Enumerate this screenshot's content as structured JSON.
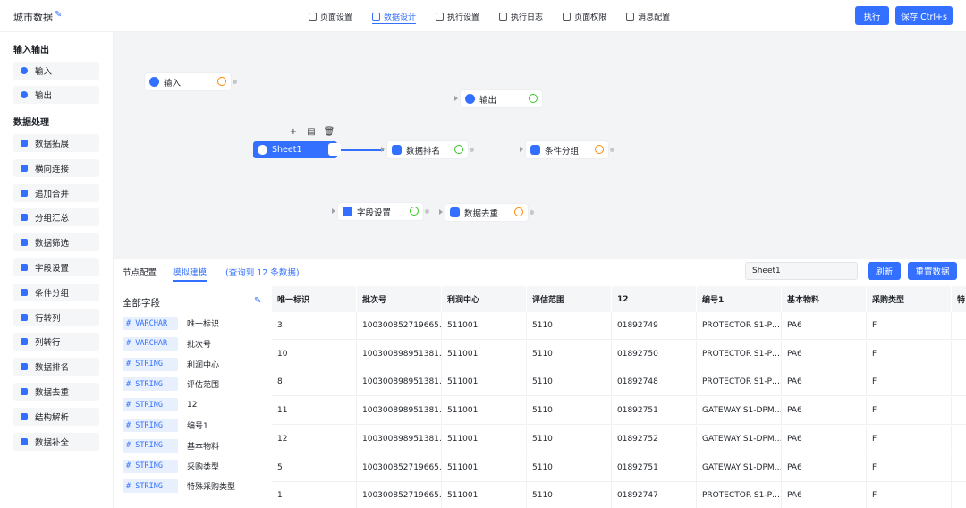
{
  "app": {
    "title": "城市数据",
    "accent": "#3370ff"
  },
  "nav": [
    "页面设置",
    "数据设计",
    "执行设置",
    "执行日志",
    "页面权限",
    "消息配置"
  ],
  "actions": {
    "run": "执行",
    "save": "保存 Ctrl+s"
  },
  "sidebar": {
    "io_title": "输入输出",
    "io_items": [
      "输入",
      "输出"
    ],
    "proc_title": "数据处理",
    "proc_items": [
      "数据拓展",
      "横向连接",
      "追加合并",
      "分组汇总",
      "数据筛选",
      "字段设置",
      "条件分组",
      "行转列",
      "列转行",
      "数据排名",
      "数据去重",
      "结构解析",
      "数据补全"
    ]
  },
  "canvas": {
    "nodes": {
      "input": "输入",
      "output": "输出",
      "sheet": "Sheet1",
      "rank": "数据排名",
      "group": "条件分组",
      "field": "字段设置",
      "dedup": "数据去重"
    },
    "mini_toolbar": [
      "+",
      "▤",
      "🗑"
    ]
  },
  "bottom": {
    "tabs": [
      "节点配置",
      "模拟建模"
    ],
    "query_info": "(查询到 12 条数据)",
    "search_value": "Sheet1",
    "refresh": "刷新",
    "reset": "重置数据",
    "fields_title": "全部字段",
    "fields": [
      {
        "type": "# VARCHAR",
        "name": "唯一标识"
      },
      {
        "type": "# VARCHAR",
        "name": "批次号"
      },
      {
        "type": "# STRING",
        "name": "利润中心"
      },
      {
        "type": "# STRING",
        "name": "评估范围"
      },
      {
        "type": "# STRING",
        "name": "12"
      },
      {
        "type": "# STRING",
        "name": "编号1"
      },
      {
        "type": "# STRING",
        "name": "基本物料"
      },
      {
        "type": "# STRING",
        "name": "采购类型"
      },
      {
        "type": "# STRING",
        "name": "特殊采购类型"
      }
    ],
    "columns": [
      "唯一标识",
      "批次号",
      "利润中心",
      "评估范围",
      "12",
      "编号1",
      "基本物料",
      "采购类型",
      "特"
    ],
    "rows": [
      [
        "3",
        "100300852719665…",
        "511001",
        "5110",
        "01892749",
        "PROTECTOR S1-P…",
        "PA6",
        "F",
        ""
      ],
      [
        "10",
        "100300898951381…",
        "511001",
        "5110",
        "01892750",
        "PROTECTOR S1-P…",
        "PA6",
        "F",
        ""
      ],
      [
        "8",
        "100300898951381…",
        "511001",
        "5110",
        "01892748",
        "PROTECTOR S1-P…",
        "PA6",
        "F",
        ""
      ],
      [
        "11",
        "100300898951381…",
        "511001",
        "5110",
        "01892751",
        "GATEWAY S1-DPM…",
        "PA6",
        "F",
        ""
      ],
      [
        "12",
        "100300898951381…",
        "511001",
        "5110",
        "01892752",
        "GATEWAY S1-DPM…",
        "PA6",
        "F",
        ""
      ],
      [
        "5",
        "100300852719665…",
        "511001",
        "5110",
        "01892751",
        "GATEWAY S1-DPM…",
        "PA6",
        "F",
        ""
      ],
      [
        "1",
        "100300852719665…",
        "511001",
        "5110",
        "01892747",
        "PROTECTOR S1-P…",
        "PA6",
        "F",
        ""
      ]
    ]
  }
}
